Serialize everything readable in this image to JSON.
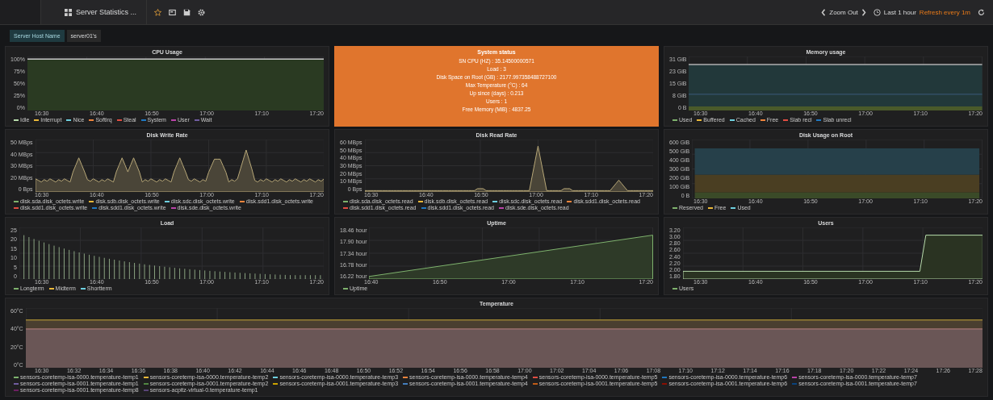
{
  "topbar": {
    "dashboard_title": "Server Statistics ...",
    "zoom_label": "Zoom Out",
    "time_range": "Last 1 hour",
    "refresh": "Refresh every 1m"
  },
  "variables": [
    {
      "label": "Server Host Name",
      "selected": true
    },
    {
      "label": "server01's",
      "selected": false
    }
  ],
  "rows": [
    [
      {
        "kind": "flat",
        "title": "CPU Usage",
        "y_labels": [
          "100%",
          "75%",
          "50%",
          "25%",
          "0%"
        ],
        "x_labels": [
          "16:30",
          "16:40",
          "16:50",
          "17:00",
          "17:10",
          "17:20"
        ],
        "legend": [
          {
            "name": "Idle",
            "color": "#b7dbab"
          },
          {
            "name": "Interrupt",
            "color": "#eab839"
          },
          {
            "name": "Nice",
            "color": "#6ed0e0"
          },
          {
            "name": "Softirq",
            "color": "#ef843c"
          },
          {
            "name": "Steal",
            "color": "#e24d42"
          },
          {
            "name": "System",
            "color": "#1f78c1"
          },
          {
            "name": "User",
            "color": "#ba43a9"
          },
          {
            "name": "Wait",
            "color": "#705da0"
          }
        ]
      },
      {
        "kind": "text",
        "title": "System status",
        "lines": [
          "SN CPU (HZ) : 35.14500000571",
          "Load : 3",
          "Disk Space on Root (GB) : 2177.997358488727100",
          "Max Temperature (°C) : 64",
          "Up since (days) : 0.213",
          "Users : 1",
          "Free Memory (MiB) : 4837.25"
        ]
      },
      {
        "kind": "bands",
        "title": "Memory usage",
        "y_labels": [
          "31 GiB",
          "23 GiB",
          "15 GiB",
          "8 GiB",
          "0 B"
        ],
        "x_labels": [
          "16:30",
          "16:40",
          "16:50",
          "17:00",
          "17:10",
          "17:20"
        ],
        "legend": [
          {
            "name": "Used",
            "color": "#7eb26d"
          },
          {
            "name": "Buffered",
            "color": "#eab839"
          },
          {
            "name": "Cached",
            "color": "#6ed0e0"
          },
          {
            "name": "Free",
            "color": "#ef843c"
          },
          {
            "name": "Slab recl",
            "color": "#e24d42"
          },
          {
            "name": "Slab unrecl",
            "color": "#1f78c1"
          }
        ]
      }
    ],
    [
      {
        "kind": "spikes",
        "title": "Disk Write Rate",
        "y_labels": [
          "50 MBps",
          "40 MBps",
          "30 MBps",
          "20 MBps",
          "0 Bps"
        ],
        "x_labels": [
          "16:30",
          "16:40",
          "16:50",
          "17:00",
          "17:10",
          "17:20"
        ],
        "legend": [
          {
            "name": "disk.sda.disk_octets.write",
            "color": "#7eb26d"
          },
          {
            "name": "disk.sdb.disk_octets.write",
            "color": "#eab839"
          },
          {
            "name": "disk.sdc.disk_octets.write",
            "color": "#6ed0e0"
          },
          {
            "name": "disk.sdd1.disk_octets.write",
            "color": "#ef843c"
          },
          {
            "name": "disk.sdd1.disk_octets.write",
            "color": "#e24d42"
          },
          {
            "name": "disk.sdd1.disk_octets.write",
            "color": "#1f78c1"
          },
          {
            "name": "disk.sde.disk_octets.write",
            "color": "#ba43a9"
          }
        ]
      },
      {
        "kind": "peaks",
        "title": "Disk Read Rate",
        "y_labels": [
          "60 MBps",
          "50 MBps",
          "40 MBps",
          "30 MBps",
          "20 MBps",
          "10 MBps",
          "0 Bps"
        ],
        "x_labels": [
          "16:30",
          "16:40",
          "16:50",
          "17:00",
          "17:10",
          "17:20"
        ],
        "legend": [
          {
            "name": "disk.sda.disk_octets.read",
            "color": "#7eb26d"
          },
          {
            "name": "disk.sdb.disk_octets.read",
            "color": "#eab839"
          },
          {
            "name": "disk.sdc.disk_octets.read",
            "color": "#6ed0e0"
          },
          {
            "name": "disk.sdd1.disk_octets.read",
            "color": "#ef843c"
          },
          {
            "name": "disk.sdd1.disk_octets.read",
            "color": "#e24d42"
          },
          {
            "name": "disk.sdd1.disk_octets.read",
            "color": "#1f78c1"
          },
          {
            "name": "disk.sde.disk_octets.read",
            "color": "#ba43a9"
          }
        ]
      },
      {
        "kind": "stack",
        "title": "Disk Usage on Root",
        "y_labels": [
          "600 GiB",
          "500 GiB",
          "400 GiB",
          "300 GiB",
          "200 GiB",
          "100 GiB",
          "0 B"
        ],
        "x_labels": [
          "16:30",
          "16:40",
          "16:50",
          "17:00",
          "17:10",
          "17:20"
        ],
        "legend": [
          {
            "name": "Reserved",
            "color": "#7eb26d"
          },
          {
            "name": "Free",
            "color": "#eab839"
          },
          {
            "name": "Used",
            "color": "#6ed0e0"
          }
        ]
      }
    ],
    [
      {
        "kind": "bars",
        "title": "Load",
        "y_labels": [
          "25",
          "20",
          "15",
          "10",
          "5",
          "0"
        ],
        "x_labels": [
          "16:30",
          "16:40",
          "16:50",
          "17:00",
          "17:10",
          "17:20"
        ],
        "legend": [
          {
            "name": "Longterm",
            "color": "#7eb26d"
          },
          {
            "name": "Midterm",
            "color": "#eab839"
          },
          {
            "name": "Shortterm",
            "color": "#6ed0e0"
          }
        ]
      },
      {
        "kind": "ramp",
        "title": "Uptime",
        "y_labels": [
          "18.46 hour",
          "17.90 hour",
          "17.34 hour",
          "16.78 hour",
          "16.22 hour"
        ],
        "x_labels": [
          "16:40",
          "16:50",
          "17:00",
          "17:10",
          "17:20"
        ],
        "legend": [
          {
            "name": "Uptime",
            "color": "#7eb26d"
          }
        ]
      },
      {
        "kind": "step",
        "title": "Users",
        "y_labels": [
          "3.20",
          "3.00",
          "2.80",
          "2.60",
          "2.40",
          "2.20",
          "2.00",
          "1.80"
        ],
        "x_labels": [
          "16:30",
          "16:40",
          "16:50",
          "17:00",
          "17:10",
          "17:20"
        ],
        "legend": [
          {
            "name": "Users",
            "color": "#7eb26d"
          }
        ]
      }
    ],
    [
      {
        "kind": "temps",
        "title": "Temperature",
        "y_labels": [
          "60°C",
          "40°C",
          "20°C",
          "0°C"
        ],
        "x_labels": [
          "16:30",
          "16:32",
          "16:34",
          "16:36",
          "16:38",
          "16:40",
          "16:42",
          "16:44",
          "16:46",
          "16:48",
          "16:50",
          "16:52",
          "16:54",
          "16:56",
          "16:58",
          "17:00",
          "17:02",
          "17:04",
          "17:06",
          "17:08",
          "17:10",
          "17:12",
          "17:14",
          "17:16",
          "17:18",
          "17:20",
          "17:22",
          "17:24",
          "17:26",
          "17:28"
        ],
        "legend": [
          {
            "name": "sensors-coretemp-isa-0000.temperature-temp1",
            "color": "#7eb26d"
          },
          {
            "name": "sensors-coretemp-isa-0000.temperature-temp2",
            "color": "#eab839"
          },
          {
            "name": "sensors-coretemp-isa-0000.temperature-temp3",
            "color": "#6ed0e0"
          },
          {
            "name": "sensors-coretemp-isa-0000.temperature-temp4",
            "color": "#ef843c"
          },
          {
            "name": "sensors-coretemp-isa-0000.temperature-temp5",
            "color": "#e24d42"
          },
          {
            "name": "sensors-coretemp-isa-0000.temperature-temp6",
            "color": "#1f78c1"
          },
          {
            "name": "sensors-coretemp-isa-0000.temperature-temp7",
            "color": "#ba43a9"
          },
          {
            "name": "sensors-coretemp-isa-0001.temperature-temp1",
            "color": "#705da0"
          },
          {
            "name": "sensors-coretemp-isa-0001.temperature-temp2",
            "color": "#508642"
          },
          {
            "name": "sensors-coretemp-isa-0001.temperature-temp3",
            "color": "#cca300"
          },
          {
            "name": "sensors-coretemp-isa-0001.temperature-temp4",
            "color": "#447ebc"
          },
          {
            "name": "sensors-coretemp-isa-0001.temperature-temp5",
            "color": "#c15c17"
          },
          {
            "name": "sensors-coretemp-isa-0001.temperature-temp6",
            "color": "#890f02"
          },
          {
            "name": "sensors-coretemp-isa-0001.temperature-temp7",
            "color": "#0a437c"
          },
          {
            "name": "sensors-coretemp-isa-0001.temperature-temp8",
            "color": "#6d1f62"
          },
          {
            "name": "sensors-acpitz-virtual-0.temperature-temp1",
            "color": "#584477"
          }
        ]
      }
    ]
  ]
}
